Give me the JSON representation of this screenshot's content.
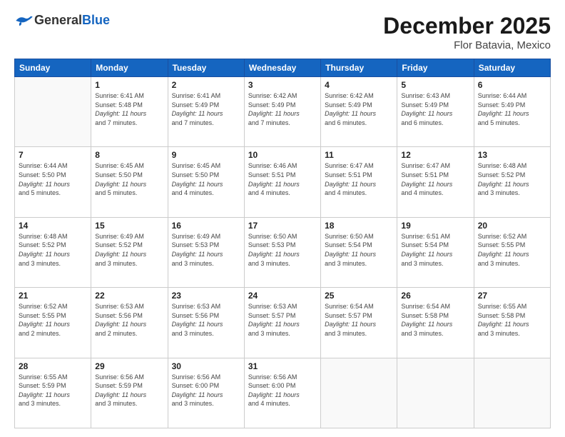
{
  "header": {
    "logo_general": "General",
    "logo_blue": "Blue",
    "title": "December 2025",
    "subtitle": "Flor Batavia, Mexico"
  },
  "weekdays": [
    "Sunday",
    "Monday",
    "Tuesday",
    "Wednesday",
    "Thursday",
    "Friday",
    "Saturday"
  ],
  "weeks": [
    [
      {
        "day": "",
        "info": ""
      },
      {
        "day": "1",
        "info": "Sunrise: 6:41 AM\nSunset: 5:48 PM\nDaylight: 11 hours\nand 7 minutes."
      },
      {
        "day": "2",
        "info": "Sunrise: 6:41 AM\nSunset: 5:49 PM\nDaylight: 11 hours\nand 7 minutes."
      },
      {
        "day": "3",
        "info": "Sunrise: 6:42 AM\nSunset: 5:49 PM\nDaylight: 11 hours\nand 7 minutes."
      },
      {
        "day": "4",
        "info": "Sunrise: 6:42 AM\nSunset: 5:49 PM\nDaylight: 11 hours\nand 6 minutes."
      },
      {
        "day": "5",
        "info": "Sunrise: 6:43 AM\nSunset: 5:49 PM\nDaylight: 11 hours\nand 6 minutes."
      },
      {
        "day": "6",
        "info": "Sunrise: 6:44 AM\nSunset: 5:49 PM\nDaylight: 11 hours\nand 5 minutes."
      }
    ],
    [
      {
        "day": "7",
        "info": "Sunrise: 6:44 AM\nSunset: 5:50 PM\nDaylight: 11 hours\nand 5 minutes."
      },
      {
        "day": "8",
        "info": "Sunrise: 6:45 AM\nSunset: 5:50 PM\nDaylight: 11 hours\nand 5 minutes."
      },
      {
        "day": "9",
        "info": "Sunrise: 6:45 AM\nSunset: 5:50 PM\nDaylight: 11 hours\nand 4 minutes."
      },
      {
        "day": "10",
        "info": "Sunrise: 6:46 AM\nSunset: 5:51 PM\nDaylight: 11 hours\nand 4 minutes."
      },
      {
        "day": "11",
        "info": "Sunrise: 6:47 AM\nSunset: 5:51 PM\nDaylight: 11 hours\nand 4 minutes."
      },
      {
        "day": "12",
        "info": "Sunrise: 6:47 AM\nSunset: 5:51 PM\nDaylight: 11 hours\nand 4 minutes."
      },
      {
        "day": "13",
        "info": "Sunrise: 6:48 AM\nSunset: 5:52 PM\nDaylight: 11 hours\nand 3 minutes."
      }
    ],
    [
      {
        "day": "14",
        "info": "Sunrise: 6:48 AM\nSunset: 5:52 PM\nDaylight: 11 hours\nand 3 minutes."
      },
      {
        "day": "15",
        "info": "Sunrise: 6:49 AM\nSunset: 5:52 PM\nDaylight: 11 hours\nand 3 minutes."
      },
      {
        "day": "16",
        "info": "Sunrise: 6:49 AM\nSunset: 5:53 PM\nDaylight: 11 hours\nand 3 minutes."
      },
      {
        "day": "17",
        "info": "Sunrise: 6:50 AM\nSunset: 5:53 PM\nDaylight: 11 hours\nand 3 minutes."
      },
      {
        "day": "18",
        "info": "Sunrise: 6:50 AM\nSunset: 5:54 PM\nDaylight: 11 hours\nand 3 minutes."
      },
      {
        "day": "19",
        "info": "Sunrise: 6:51 AM\nSunset: 5:54 PM\nDaylight: 11 hours\nand 3 minutes."
      },
      {
        "day": "20",
        "info": "Sunrise: 6:52 AM\nSunset: 5:55 PM\nDaylight: 11 hours\nand 3 minutes."
      }
    ],
    [
      {
        "day": "21",
        "info": "Sunrise: 6:52 AM\nSunset: 5:55 PM\nDaylight: 11 hours\nand 2 minutes."
      },
      {
        "day": "22",
        "info": "Sunrise: 6:53 AM\nSunset: 5:56 PM\nDaylight: 11 hours\nand 2 minutes."
      },
      {
        "day": "23",
        "info": "Sunrise: 6:53 AM\nSunset: 5:56 PM\nDaylight: 11 hours\nand 3 minutes."
      },
      {
        "day": "24",
        "info": "Sunrise: 6:53 AM\nSunset: 5:57 PM\nDaylight: 11 hours\nand 3 minutes."
      },
      {
        "day": "25",
        "info": "Sunrise: 6:54 AM\nSunset: 5:57 PM\nDaylight: 11 hours\nand 3 minutes."
      },
      {
        "day": "26",
        "info": "Sunrise: 6:54 AM\nSunset: 5:58 PM\nDaylight: 11 hours\nand 3 minutes."
      },
      {
        "day": "27",
        "info": "Sunrise: 6:55 AM\nSunset: 5:58 PM\nDaylight: 11 hours\nand 3 minutes."
      }
    ],
    [
      {
        "day": "28",
        "info": "Sunrise: 6:55 AM\nSunset: 5:59 PM\nDaylight: 11 hours\nand 3 minutes."
      },
      {
        "day": "29",
        "info": "Sunrise: 6:56 AM\nSunset: 5:59 PM\nDaylight: 11 hours\nand 3 minutes."
      },
      {
        "day": "30",
        "info": "Sunrise: 6:56 AM\nSunset: 6:00 PM\nDaylight: 11 hours\nand 3 minutes."
      },
      {
        "day": "31",
        "info": "Sunrise: 6:56 AM\nSunset: 6:00 PM\nDaylight: 11 hours\nand 4 minutes."
      },
      {
        "day": "",
        "info": ""
      },
      {
        "day": "",
        "info": ""
      },
      {
        "day": "",
        "info": ""
      }
    ]
  ]
}
